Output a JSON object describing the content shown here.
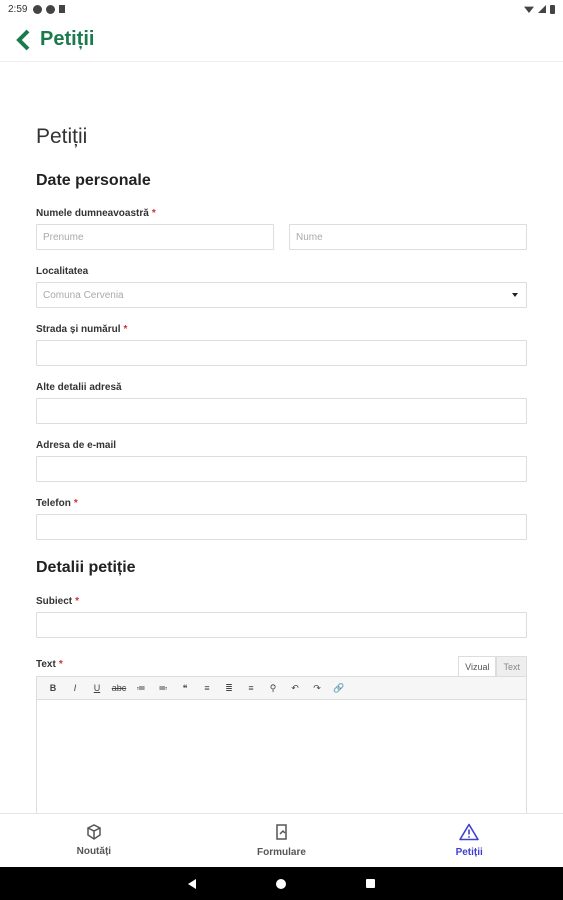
{
  "status_bar": {
    "time": "2:59"
  },
  "app_bar": {
    "title": "Petiții"
  },
  "page": {
    "heading": "Petiții"
  },
  "sections": {
    "personal": "Date personale",
    "petition": "Detalii petiție"
  },
  "fields": {
    "name_label": "Numele dumneavoastră",
    "first_name_placeholder": "Prenume",
    "last_name_placeholder": "Nume",
    "locality_label": "Localitatea",
    "locality_value": "Comuna Cervenia",
    "street_label": "Strada și numărul",
    "address_details_label": "Alte detalii adresă",
    "email_label": "Adresa de e-mail",
    "phone_label": "Telefon",
    "subject_label": "Subiect",
    "text_label": "Text",
    "required_mark": "*"
  },
  "editor": {
    "tabs": [
      "Vizual",
      "Text"
    ],
    "toolbar": [
      "B",
      "I",
      "U",
      "abc",
      "≔",
      "≕",
      "❝",
      "≡",
      "≣",
      "≡",
      "⚲",
      "↶",
      "↷",
      "🔗"
    ]
  },
  "bottom_nav": {
    "items": [
      {
        "label": "Noutăți",
        "icon": "news-icon"
      },
      {
        "label": "Formulare",
        "icon": "forms-icon"
      },
      {
        "label": "Petiții",
        "icon": "warning-icon"
      }
    ],
    "active_index": 2
  },
  "colors": {
    "accent": "#1a7a4c",
    "active_nav": "#3f3fd0",
    "required": "#d32f2f"
  }
}
